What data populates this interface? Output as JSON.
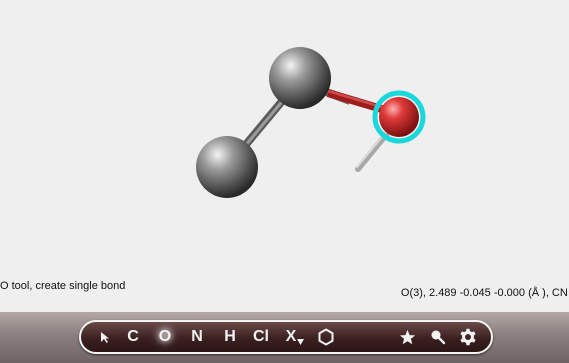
{
  "status": {
    "tool_hint": "O tool, create single bond",
    "atom_info": "O(3), 2.489 -0.045 -0.000 (Å ), CN 1"
  },
  "toolbar": {
    "tools": [
      {
        "name": "select",
        "label": ""
      },
      {
        "name": "carbon",
        "label": "C"
      },
      {
        "name": "oxygen",
        "label": "O",
        "selected": true
      },
      {
        "name": "nitrogen",
        "label": "N"
      },
      {
        "name": "hydrogen",
        "label": "H"
      },
      {
        "name": "chlorine",
        "label": "Cl"
      },
      {
        "name": "other-element",
        "label": "X"
      },
      {
        "name": "ring",
        "label": ""
      },
      {
        "name": "favorite",
        "label": ""
      },
      {
        "name": "pin",
        "label": ""
      },
      {
        "name": "settings",
        "label": ""
      }
    ]
  },
  "colors": {
    "oxygen": "#e03030",
    "carbon": "#6a6a6a",
    "highlight": "#19d8dc",
    "toolbar_bg": "#3b2020"
  },
  "icons": [
    "arrow-cursor-icon",
    "hexagon-ring-icon",
    "star-icon",
    "pin-icon",
    "gear-icon"
  ]
}
